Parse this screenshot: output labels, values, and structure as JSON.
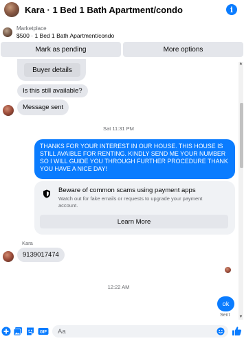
{
  "header": {
    "title": "Kara · 1 Bed 1 Bath Apartment/condo",
    "info_label": "i"
  },
  "listing": {
    "source": "Marketplace",
    "title": "$500 · 1 Bed 1 Bath Apartment/condo"
  },
  "actions": {
    "mark_pending": "Mark as pending",
    "more_options": "More options"
  },
  "messages": {
    "buyer_details": "Buyer details",
    "is_available": "Is this still available?",
    "message_sent": "Message sent",
    "time_1": "Sat 11:31 PM",
    "long_message": "THANKS FOR YOUR INTEREST IN OUR HOUSE. THIS HOUSE IS STILL AVAIBLE FOR RENTING. KINDLY SEND ME YOUR NUMBER SO I WILL GUIDE YOU THROUGH FURTHER PROCEDURE THANK YOU HAVE A NICE DAY!",
    "scam_title": "Beware of common scams using payment apps",
    "scam_body": "Watch out for fake emails or requests to upgrade your payment account.",
    "learn_more": "Learn More",
    "sender_name": "Kara",
    "phone": "9139017474",
    "time_2": "12:22 AM",
    "ok": "ok",
    "sent_status": "Sent"
  },
  "composer": {
    "placeholder": "Aa",
    "gif_label": "GIF"
  },
  "colors": {
    "accent": "#0a7cff",
    "bubble_grey": "#e4e6eb",
    "card_bg": "#f0f2f5",
    "secondary_text": "#65676b"
  }
}
